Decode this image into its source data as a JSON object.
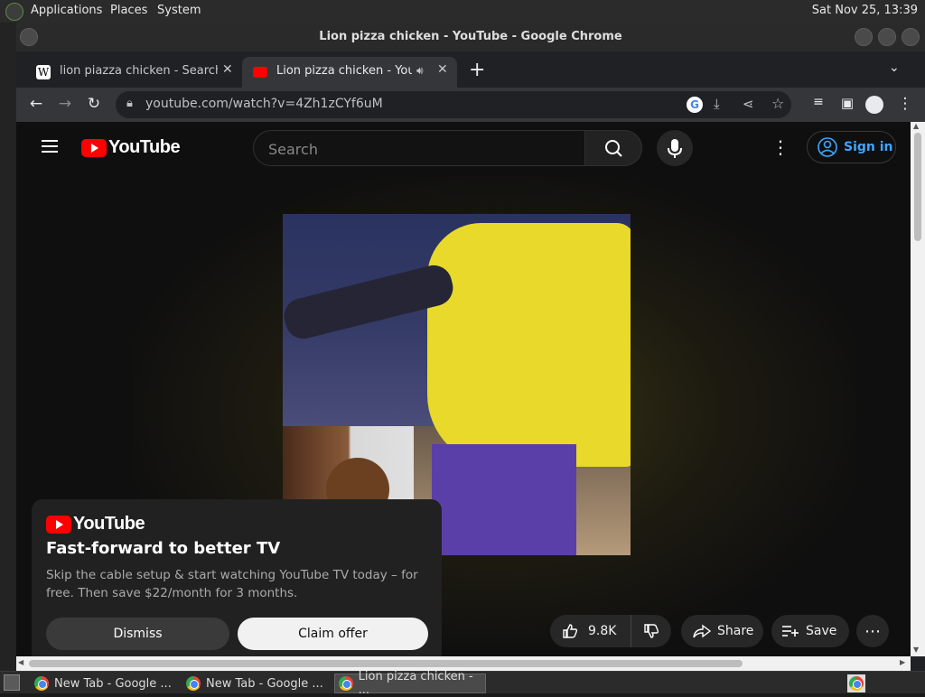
{
  "top_panel": {
    "menus": [
      "Applications",
      "Places",
      "System"
    ],
    "clock": "Sat Nov 25, 13:39"
  },
  "window": {
    "title": "Lion pizza chicken - YouTube - Google Chrome"
  },
  "tabs": [
    {
      "label": "lion piazza chicken - Search re",
      "favicon": "wikipedia-icon",
      "close": "✕"
    },
    {
      "label": "Lion pizza chicken - YouTu",
      "favicon": "youtube-icon",
      "close": "✕",
      "audio_icon": "speaker-icon"
    }
  ],
  "new_tab": "+",
  "toolbar": {
    "url": "youtube.com/watch?v=4Zh1zCYf6uM",
    "icons": [
      "back-icon",
      "forward-icon",
      "reload-icon",
      "google-lens-icon",
      "install-icon",
      "share-icon",
      "bookmark-star-icon",
      "media-control-icon",
      "sidepanel-icon",
      "profile-icon",
      "menu-icon"
    ]
  },
  "youtube": {
    "logo_text": "YouTube",
    "search_placeholder": "Search",
    "sign_in": "Sign in"
  },
  "promo": {
    "logo_text": "YouTube",
    "headline": "Fast-forward to better TV",
    "body": "Skip the cable setup & start watching YouTube TV today – for free. Then save $22/month for 3 months.",
    "dismiss": "Dismiss",
    "claim": "Claim offer"
  },
  "actions": {
    "likes": "9.8K",
    "share": "Share",
    "save": "Save"
  },
  "taskbar": {
    "items": [
      "New Tab - Google ...",
      "New Tab - Google ...",
      "Lion pizza chicken - ..."
    ]
  }
}
